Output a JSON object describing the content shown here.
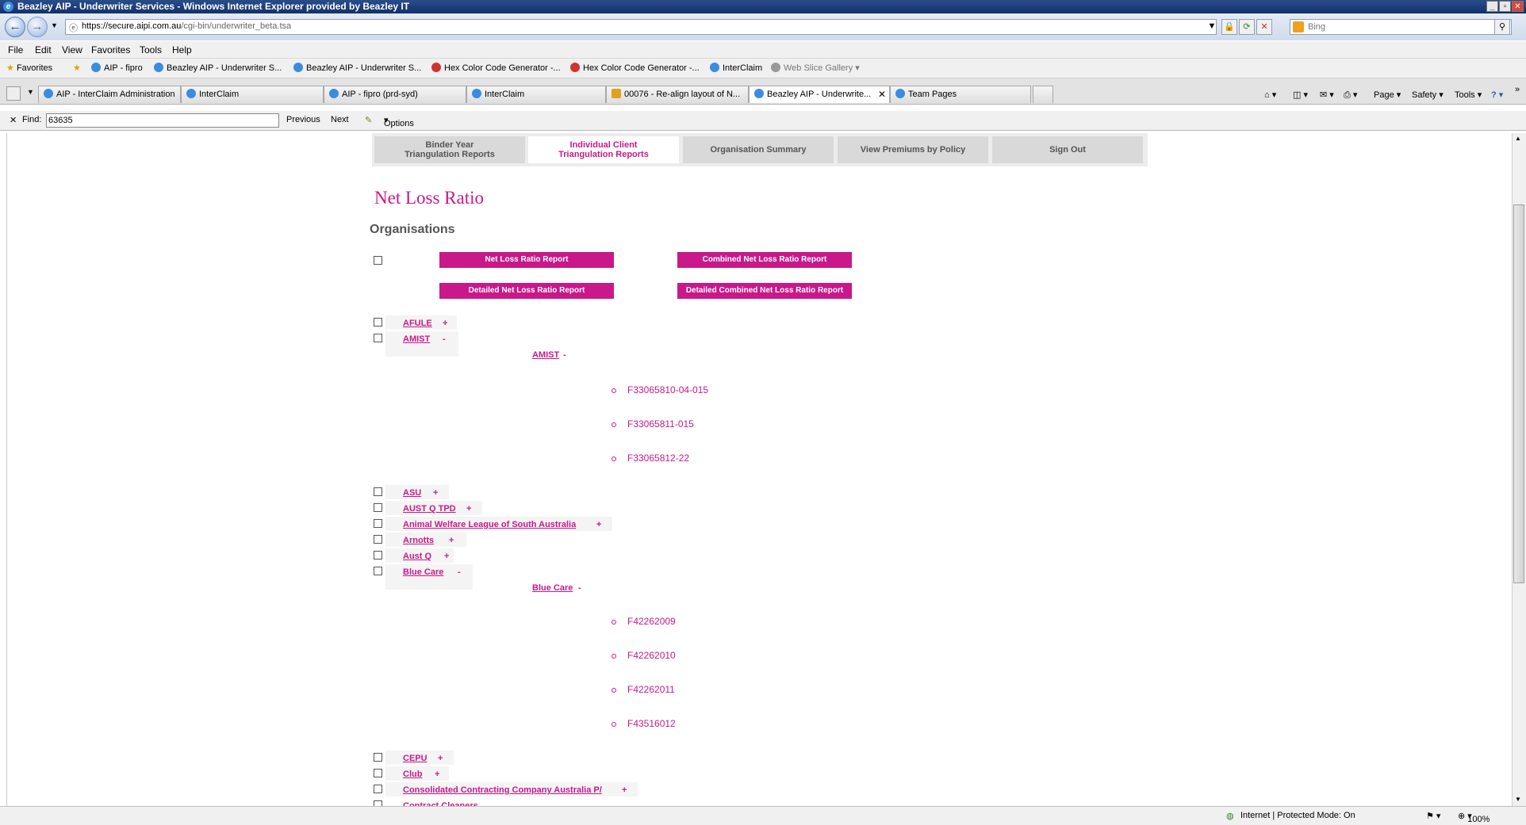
{
  "window": {
    "title": "Beazley AIP - Underwriter Services - Windows Internet Explorer provided by Beazley IT",
    "url_host": "https://secure.aipi.com.au",
    "url_path": "/cgi-bin/underwriter_beta.tsa",
    "search_placeholder": "Bing"
  },
  "menu": [
    "File",
    "Edit",
    "View",
    "Favorites",
    "Tools",
    "Help"
  ],
  "favorites": {
    "label": "Favorites",
    "items": [
      "AIP - fipro",
      "Beazley AIP - Underwriter S...",
      "Beazley AIP - Underwriter S...",
      "Hex Color Code Generator -...",
      "Hex Color Code Generator -...",
      "InterClaim",
      "Web Slice Gallery"
    ]
  },
  "tabs": [
    {
      "label": "AIP - InterClaim Administration"
    },
    {
      "label": "InterClaim"
    },
    {
      "label": "AIP - fipro (prd-syd)"
    },
    {
      "label": "InterClaim"
    },
    {
      "label": "00076 - Re-align layout of N..."
    },
    {
      "label": "Beazley AIP - Underwrite..."
    },
    {
      "label": "Team Pages"
    }
  ],
  "command_bar": [
    "Page",
    "Safety",
    "Tools"
  ],
  "find": {
    "label": "Find:",
    "value": "63635",
    "previous": "Previous",
    "next": "Next",
    "options": "Options"
  },
  "nav": [
    {
      "line1": "Binder Year",
      "line2": "Triangulation Reports"
    },
    {
      "line1": "Individual Client",
      "line2": "Triangulation Reports"
    },
    {
      "line1": "Organisation Summary",
      "line2": ""
    },
    {
      "line1": "View Premiums by Policy",
      "line2": ""
    },
    {
      "line1": "Sign Out",
      "line2": ""
    }
  ],
  "page": {
    "title": "Net Loss Ratio",
    "subtitle": "Organisations"
  },
  "buttons": {
    "net_loss": "Net Loss Ratio Report",
    "combined": "Combined Net Loss Ratio Report",
    "detailed": "Detailed Net Loss Ratio Report",
    "detailed_combined": "Detailed Combined Net Loss Ratio Report"
  },
  "orgs": [
    {
      "name": "AFULE",
      "toggle": "+"
    },
    {
      "name": "AMIST",
      "toggle": "-",
      "sub": "AMIST",
      "sub_toggle": "-",
      "policies": [
        "F33065810-04-015",
        "F33065811-015",
        "F33065812-22"
      ]
    },
    {
      "name": "ASU",
      "toggle": "+"
    },
    {
      "name": "AUST Q TPD",
      "toggle": "+"
    },
    {
      "name": "Animal Welfare League of South Australia",
      "toggle": "+"
    },
    {
      "name": "Arnotts",
      "toggle": "+"
    },
    {
      "name": "Aust Q",
      "toggle": "+"
    },
    {
      "name": "Blue Care",
      "toggle": "-",
      "sub": "Blue Care",
      "sub_toggle": "-",
      "policies": [
        "F42262009",
        "F42262010",
        "F42262011",
        "F43516012"
      ]
    },
    {
      "name": "CEPU",
      "toggle": "+"
    },
    {
      "name": "Club",
      "toggle": "+"
    },
    {
      "name": "Consolidated Contracting Company Australia P/",
      "toggle": "+"
    },
    {
      "name": "Contract Cleaners",
      "toggle": "+"
    }
  ],
  "status": {
    "zone": "Internet | Protected Mode: On",
    "zoom": "100%"
  }
}
